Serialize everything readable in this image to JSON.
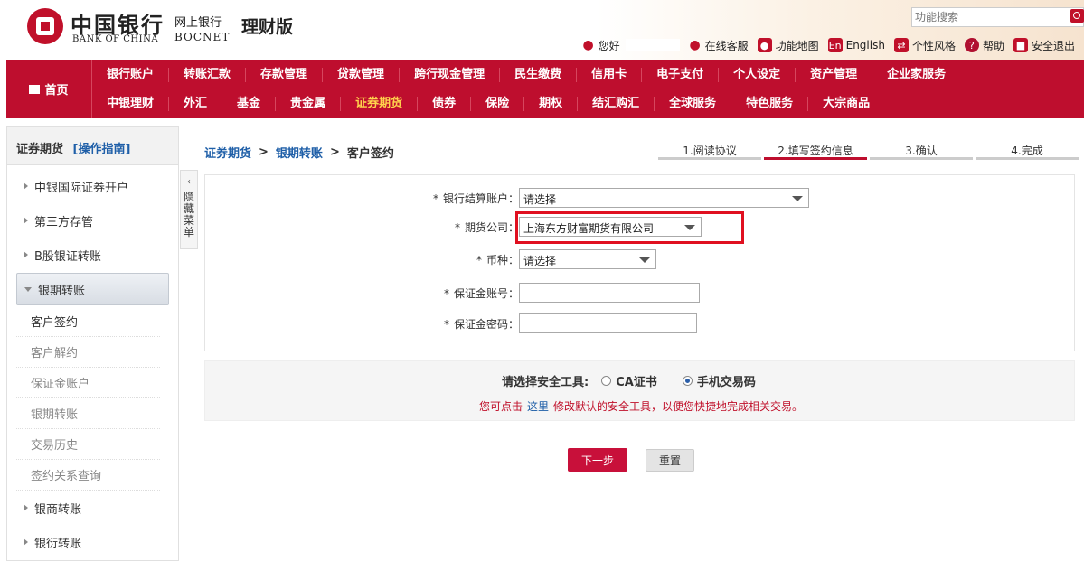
{
  "header": {
    "logo_cn": "中国银行",
    "logo_en": "BANK OF CHINA",
    "net_cn": "网上银行",
    "net_en": "BOCNET",
    "edition": "理财版",
    "search_placeholder": "功能搜索",
    "greeting": "您好",
    "links": {
      "online_service": "在线客服",
      "function_map": "功能地图",
      "english": "English",
      "style": "个性风格",
      "help": "帮助",
      "logout": "安全退出"
    }
  },
  "nav": {
    "home": "首页",
    "row1": [
      "银行账户",
      "转账汇款",
      "存款管理",
      "贷款管理",
      "跨行现金管理",
      "民生缴费",
      "信用卡",
      "电子支付",
      "个人设定",
      "资产管理",
      "企业家服务"
    ],
    "row2": [
      "中银理财",
      "外汇",
      "基金",
      "贵金属",
      "证券期货",
      "债券",
      "保险",
      "期权",
      "结汇购汇",
      "全球服务",
      "特色服务",
      "大宗商品"
    ],
    "active": "证券期货"
  },
  "sidebar": {
    "title": "证券期货",
    "guide": "[操作指南]",
    "items": [
      "中银国际证券开户",
      "第三方存管",
      "B股银证转账",
      "银期转账"
    ],
    "open_item": "银期转账",
    "subitems": [
      "客户签约",
      "客户解约",
      "保证金账户",
      "银期转账",
      "交易历史",
      "签约关系查询"
    ],
    "current_sub": "客户签约",
    "items_after": [
      "银商转账",
      "银衍转账"
    ],
    "hide_tab": "隐藏菜单",
    "hide_chevron": "‹"
  },
  "breadcrumb": {
    "level1": "证券期货",
    "level2": "银期转账",
    "level3": "客户签约",
    "sep": ">"
  },
  "steps": [
    "1.阅读协议",
    "2.填写签约信息",
    "3.确认",
    "4.完成"
  ],
  "active_step": 1,
  "form": {
    "required_mark": "*",
    "settlement_account_label": "银行结算账户：",
    "settlement_account_value": "请选择",
    "futures_company_label": "期货公司：",
    "futures_company_value": "上海东方财富期货有限公司",
    "currency_label": "币种：",
    "currency_value": "请选择",
    "margin_account_label": "保证金账号：",
    "margin_account_value": "",
    "margin_password_label": "保证金密码："
  },
  "security": {
    "label": "请选择安全工具:",
    "options": [
      "CA证书",
      "手机交易码"
    ],
    "selected": "手机交易码",
    "note_before": "您可点击",
    "note_link": "这里",
    "note_after": "修改默认的安全工具，以便您快捷地完成相关交易。"
  },
  "buttons": {
    "next": "下一步",
    "reset": "重置"
  },
  "colors": {
    "brand_red": "#be0e2e",
    "nav_active": "#ffd34d",
    "link_blue": "#1f5fa8",
    "highlight_box": "#e01020"
  }
}
